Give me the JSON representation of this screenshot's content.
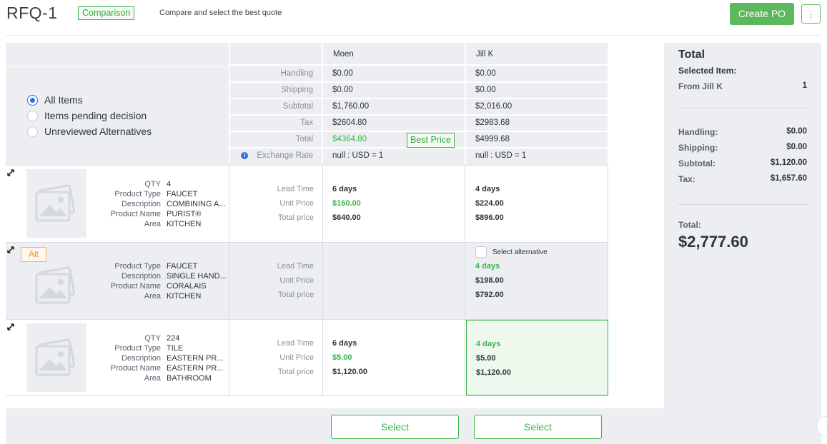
{
  "header": {
    "title": "RFQ-1",
    "mode_badge": "Comparison",
    "subtitle": "Compare and select the best quote",
    "create_po": "Create PO",
    "more": "⋮"
  },
  "filters": {
    "options": [
      "All Items",
      "Items pending decision",
      "Unreviewed Alternatives"
    ],
    "selected": "All Items"
  },
  "summary": {
    "labels": [
      "Handling",
      "Shipping",
      "Subtotal",
      "Tax",
      "Total",
      "Exchange Rate"
    ],
    "best_badge": "Best Price",
    "vendors": [
      {
        "name": "Moen",
        "handling": "$0.00",
        "shipping": "$0.00",
        "subtotal": "$1,760.00",
        "tax": "$2604.80",
        "total": "$4364.80",
        "exchange": "null : USD = 1",
        "best": true
      },
      {
        "name": "Jill K",
        "handling": "$0.00",
        "shipping": "$0.00",
        "subtotal": "$2,016.00",
        "tax": "$2983.68",
        "total": "$4999.68",
        "exchange": "null : USD = 1",
        "best": false
      }
    ]
  },
  "price_labels": [
    "Lead Time",
    "Unit Price",
    "Total price"
  ],
  "items": [
    {
      "alt": false,
      "attributes": [
        {
          "k": "QTY",
          "v": "4"
        },
        {
          "k": "Product Type",
          "v": "FAUCET"
        },
        {
          "k": "Description",
          "v": "COMBINING A..."
        },
        {
          "k": "Product Name",
          "v": "PURIST®"
        },
        {
          "k": "Area",
          "v": "KITCHEN"
        }
      ],
      "quotes": [
        {
          "lead": "6 days",
          "unit": "$160.00",
          "total": "$640.00",
          "unit_best": true,
          "lead_best": false
        },
        {
          "lead": "4 days",
          "unit": "$224.00",
          "total": "$896.00",
          "unit_best": false,
          "lead_best": false
        }
      ]
    },
    {
      "alt": true,
      "alt_label": "Alt",
      "select_alt_label": "Select alternative",
      "attributes": [
        {
          "k": "Product Type",
          "v": "FAUCET"
        },
        {
          "k": "Description",
          "v": "SINGLE HAND..."
        },
        {
          "k": "Product Name",
          "v": "CORALAIS"
        },
        {
          "k": "Area",
          "v": "KITCHEN"
        }
      ],
      "quotes": [
        null,
        {
          "lead": "4 days",
          "unit": "$198.00",
          "total": "$792.00",
          "unit_best": false,
          "lead_best": true
        }
      ]
    },
    {
      "alt": false,
      "attributes": [
        {
          "k": "QTY",
          "v": "224"
        },
        {
          "k": "Product Type",
          "v": "TILE"
        },
        {
          "k": "Description",
          "v": "EASTERN PR..."
        },
        {
          "k": "Product Name",
          "v": "EASTERN PR..."
        },
        {
          "k": "Area",
          "v": "BATHROOM"
        }
      ],
      "quotes": [
        {
          "lead": "6 days",
          "unit": "$5.00",
          "total": "$1,120.00",
          "unit_best": true,
          "lead_best": false
        },
        {
          "lead": "4 days",
          "unit": "$5.00",
          "total": "$1,120.00",
          "unit_best": false,
          "lead_best": true,
          "selected": true
        }
      ]
    }
  ],
  "footer": {
    "select_label": "Select"
  },
  "totals_panel": {
    "title": "Total",
    "selected_item_label": "Selected Item:",
    "from_label": "From Jill K",
    "from_count": "1",
    "lines": [
      {
        "k": "Handling:",
        "v": "$0.00"
      },
      {
        "k": "Shipping:",
        "v": "$0.00"
      },
      {
        "k": "Subtotal:",
        "v": "$1,120.00"
      },
      {
        "k": "Tax:",
        "v": "$1,657.60"
      }
    ],
    "total_label": "Total:",
    "total_value": "$2,777.60"
  },
  "colors": {
    "accent_green": "#3bb54a",
    "radio_blue": "#2f6fe0",
    "alt_orange": "#e8963a",
    "selected_fill": "#eef8ec"
  }
}
